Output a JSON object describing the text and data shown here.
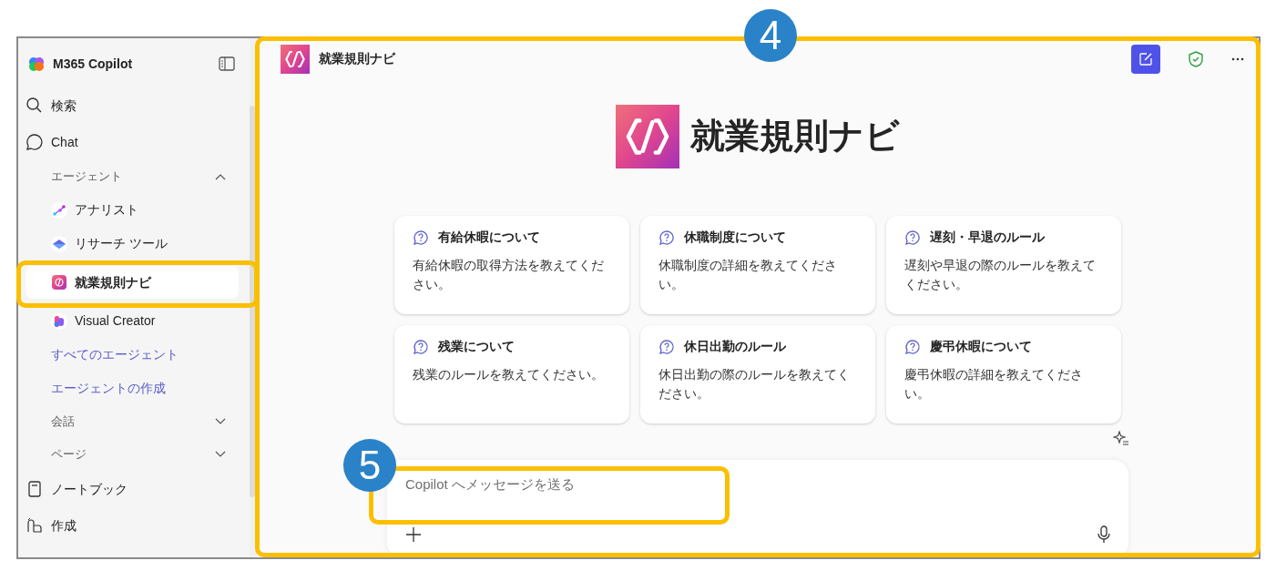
{
  "sidebar": {
    "title": "M365 Copilot",
    "items": [
      {
        "kind": "search",
        "label": "検索"
      },
      {
        "kind": "chat",
        "label": "Chat"
      },
      {
        "kind": "section",
        "label": "エージェント",
        "expanded": true
      },
      {
        "kind": "agent",
        "label": "アナリスト",
        "selected": false
      },
      {
        "kind": "agent",
        "label": "リサーチ ツール",
        "selected": false
      },
      {
        "kind": "agent",
        "label": "就業規則ナビ",
        "selected": true
      },
      {
        "kind": "agent",
        "label": "Visual Creator",
        "selected": false
      },
      {
        "kind": "link",
        "label": "すべてのエージェント"
      },
      {
        "kind": "link",
        "label": "エージェントの作成"
      },
      {
        "kind": "section",
        "label": "会話",
        "expanded": false
      },
      {
        "kind": "section",
        "label": "ページ",
        "expanded": false
      },
      {
        "kind": "notebook",
        "label": "ノートブック"
      },
      {
        "kind": "create",
        "label": "作成"
      }
    ]
  },
  "main": {
    "header_title": "就業規則ナビ",
    "hero_title": "就業規則ナビ",
    "prompts": [
      {
        "title": "有給休暇について",
        "text": "有給休暇の取得方法を教えてください。"
      },
      {
        "title": "休職制度について",
        "text": "休職制度の詳細を教えてください。"
      },
      {
        "title": "遅刻・早退のルール",
        "text": "遅刻や早退の際のルールを教えてください。"
      },
      {
        "title": "残業について",
        "text": "残業のルールを教えてください。"
      },
      {
        "title": "休日出勤のルール",
        "text": "休日出勤の際のルールを教えてください。"
      },
      {
        "title": "慶弔休暇について",
        "text": "慶弔休暇の詳細を教えてください。"
      }
    ],
    "composer": {
      "placeholder": "Copilot へメッセージを送る"
    }
  },
  "annotations": [
    {
      "label": "4"
    },
    {
      "label": "5"
    }
  ]
}
